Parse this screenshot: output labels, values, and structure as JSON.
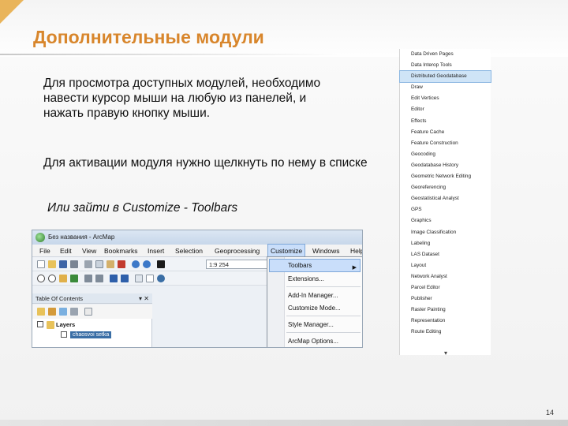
{
  "slide": {
    "title": "Дополнительные модули",
    "para1": "Для просмотра доступных модулей, необходимо навести курсор мыши на  любую из панелей, и нажать правую кнопку мыши.",
    "para2": "Для активации модуля нужно щелкнуть по нему в списке",
    "para3": "Или зайти в Customize - Toolbars",
    "page_number": "14"
  },
  "toolbar_list": {
    "items": [
      "Data Driven Pages",
      "Data Interop Tools",
      "Distributed Geodatabase",
      "Draw",
      "Edit Vertices",
      "Editor",
      "Effects",
      "Feature Cache",
      "Feature Construction",
      "Geocoding",
      "Geodatabase History",
      "Geometric Network Editing",
      "Georeferencing",
      "Geostatistical Analyst",
      "GPS",
      "Graphics",
      "Image Classification",
      "Labeling",
      "LAS Dataset",
      "Layout",
      "Network Analyst",
      "Parcel Editor",
      "Publisher",
      "Raster Painting",
      "Representation",
      "Route Editing"
    ],
    "selected_index": 2
  },
  "arcmap": {
    "window_title": "Без названия - ArcMap",
    "menu": [
      "File",
      "Edit",
      "View",
      "Bookmarks",
      "Insert",
      "Selection",
      "Geoprocessing",
      "Customize",
      "Windows",
      "Help"
    ],
    "scale": "1:9 254",
    "toc_title": "Table Of Contents",
    "layers_label": "Layers",
    "layer_name": "chaosvoi setka",
    "dropdown": {
      "items": [
        "Toolbars",
        "Extensions...",
        "Add-In Manager...",
        "Customize Mode...",
        "Style Manager...",
        "ArcMap Options..."
      ]
    }
  }
}
